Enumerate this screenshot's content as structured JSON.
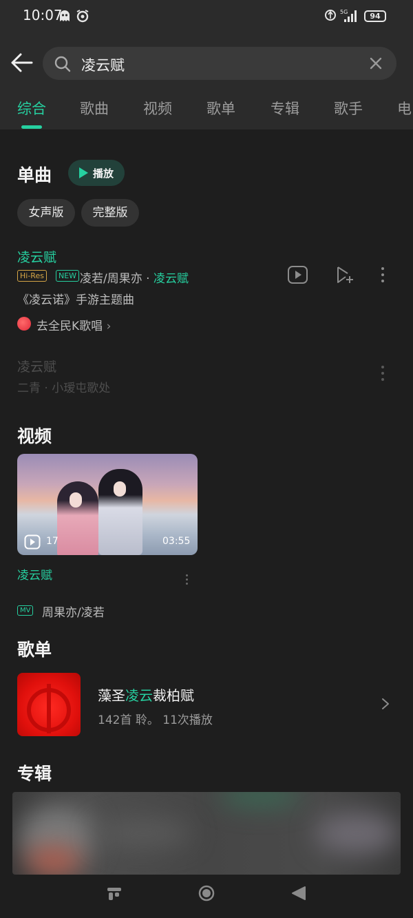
{
  "status_bar": {
    "time": "10:07",
    "network": "5G",
    "battery": "94"
  },
  "search": {
    "query": "凌云赋"
  },
  "tabs": [
    {
      "label": "综合",
      "active": true
    },
    {
      "label": "歌曲"
    },
    {
      "label": "视频"
    },
    {
      "label": "歌单"
    },
    {
      "label": "专辑"
    },
    {
      "label": "歌手"
    },
    {
      "label": "电"
    }
  ],
  "singles": {
    "heading": "单曲",
    "play_label": "播放",
    "chips": [
      "女声版",
      "完整版"
    ],
    "songs": [
      {
        "title": "凌云赋",
        "badges": [
          "Hi-Res",
          "NEW"
        ],
        "artist": "凌若/周果亦",
        "separator": " · ",
        "album": "凌云赋",
        "description": "《凌云诺》手游主题曲",
        "karaoke_link": "去全民K歌唱",
        "karaoke_chevron": "›"
      },
      {
        "title": "凌云赋",
        "artist_line": "二青 · 小瑷屯歌处"
      }
    ]
  },
  "videos": {
    "heading": "视频",
    "items": [
      {
        "title": "凌云赋",
        "play_count": "17",
        "duration": "03:55",
        "badge": "MV",
        "artist": "周果亦/凌若"
      }
    ]
  },
  "playlists": {
    "heading": "歌单",
    "items": [
      {
        "title_prefix": "藻圣",
        "title_highlight": "凌云",
        "title_suffix": "裁柏赋",
        "meta": "142首  聆。  11次播放"
      }
    ]
  },
  "albums": {
    "heading": "专辑"
  },
  "colors": {
    "accent": "#26d0a0",
    "background": "#1e1e1e",
    "header": "#2b2b2b",
    "hires": "#d6a646"
  },
  "icons": [
    "back-arrow-icon",
    "search-icon",
    "clear-icon",
    "play-icon",
    "video-icon",
    "add-to-playlist-icon",
    "more-icon",
    "kge-icon",
    "chevron-right-icon",
    "home-icon",
    "circle-nav-icon",
    "back-nav-icon"
  ]
}
